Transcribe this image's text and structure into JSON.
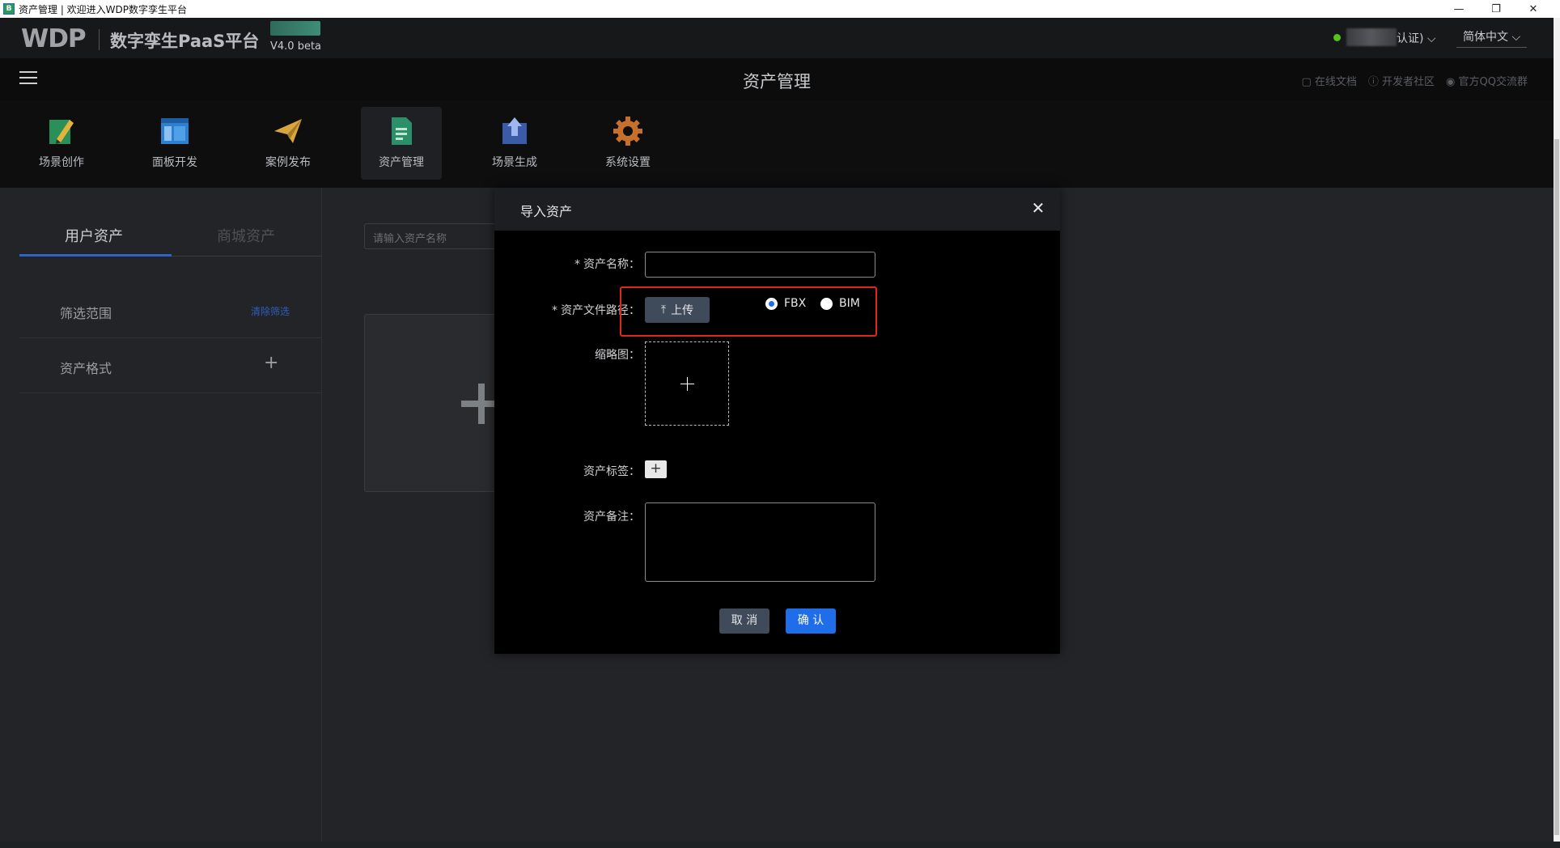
{
  "window": {
    "title": "资产管理 | 欢迎进入WDP数字孪生平台",
    "icon_letter": "B"
  },
  "header": {
    "logo": "WDP",
    "platform_name": "数字孪生PaaS平台",
    "version": "V4.0 beta",
    "user_suffix": "认证)",
    "language": "简体中文"
  },
  "subheader": {
    "page_title": "资产管理",
    "links": [
      "在线文档",
      "开发者社区",
      "官方QQ交流群"
    ]
  },
  "toolbar": {
    "items": [
      {
        "label": "场景创作",
        "icon": "scene-pen-icon"
      },
      {
        "label": "面板开发",
        "icon": "panel-layout-icon"
      },
      {
        "label": "案例发布",
        "icon": "paper-plane-icon"
      },
      {
        "label": "资产管理",
        "icon": "asset-document-icon"
      },
      {
        "label": "场景生成",
        "icon": "scene-generate-icon"
      },
      {
        "label": "系统设置",
        "icon": "gear-icon"
      }
    ]
  },
  "left_panel": {
    "tabs": [
      "用户资产",
      "商城资产"
    ],
    "filter_label": "筛选范围",
    "clear_filter": "清除筛选",
    "format_label": "资产格式"
  },
  "search": {
    "placeholder": "请输入资产名称"
  },
  "dialog": {
    "title": "导入资产",
    "fields": {
      "name_label": "资产名称：",
      "path_label": "资产文件路径：",
      "thumb_label": "缩略图：",
      "tag_label": "资产标签：",
      "note_label": "资产备注："
    },
    "upload_label": "上传",
    "radio_options": [
      {
        "label": "FBX",
        "selected": true
      },
      {
        "label": "BIM",
        "selected": false
      }
    ],
    "cancel_label": "取 消",
    "confirm_label": "确 认"
  }
}
